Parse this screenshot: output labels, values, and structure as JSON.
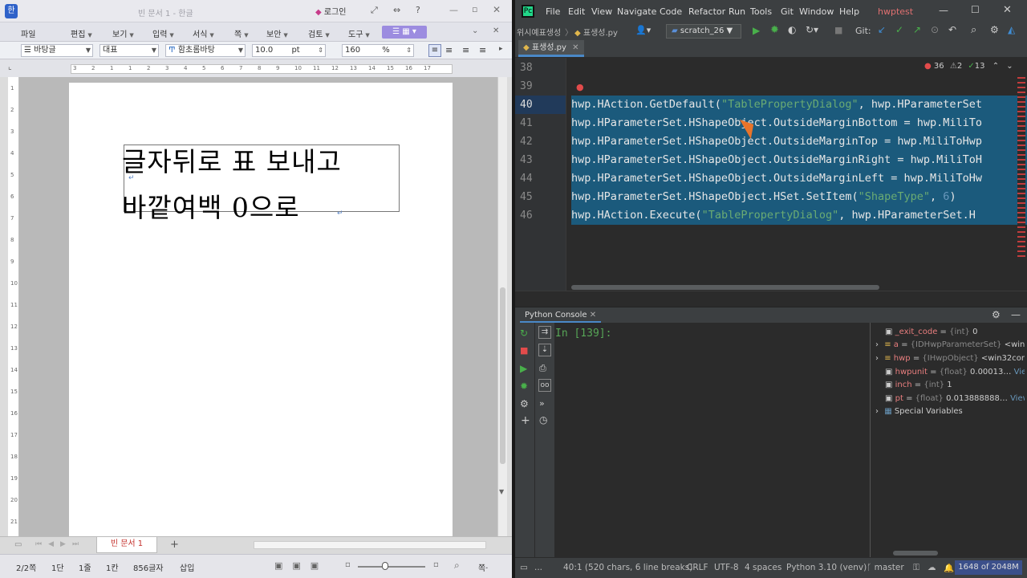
{
  "hwp": {
    "window_title": "빈 문서 1 - 한글",
    "login_label": "로그인",
    "menu": [
      "파일",
      "편집",
      "보기",
      "입력",
      "서식",
      "쪽",
      "보안",
      "검토",
      "도구"
    ],
    "format_bar": {
      "style": "바탕글",
      "lang": "대표",
      "font": "함초롬바탕",
      "size": "10.0",
      "size_unit": "pt",
      "zoom": "160",
      "zoom_unit": "%"
    },
    "ruler_numbers": [
      "3",
      "2",
      "1",
      "1",
      "2",
      "3",
      "4",
      "5",
      "6",
      "7",
      "8",
      "9",
      "10",
      "11",
      "12",
      "13",
      "14",
      "15",
      "16",
      "17"
    ],
    "vruler_numbers": [
      "1",
      "2",
      "3",
      "4",
      "5",
      "6",
      "7",
      "8",
      "9",
      "10",
      "11",
      "12",
      "13",
      "14",
      "15",
      "16",
      "17",
      "18",
      "19",
      "20",
      "21"
    ],
    "doc_line1": "글자뒤로 표 보내고",
    "doc_line2": "바깥여백 0으로",
    "doc_tab": "빈 문서 1",
    "status": {
      "page": "2/2쪽",
      "section": "1단",
      "line": "1줄",
      "col": "1칸",
      "chars": "856글자",
      "mode": "삽입",
      "zoom_tail": "쪽·"
    }
  },
  "ide": {
    "menu": [
      "File",
      "Edit",
      "View",
      "Navigate",
      "Code",
      "Refactor",
      "Run",
      "Tools",
      "Git",
      "Window",
      "Help"
    ],
    "project": "hwptest",
    "breadcrumb": "위시예표생성",
    "breadcrumb_file": "표생성.py",
    "run_config": "scratch_26",
    "git_label": "Git:",
    "file_tab": "표생성.py",
    "inspections": {
      "errors": "36",
      "warnings": "2",
      "ok": "13"
    },
    "lines": [
      {
        "no": "38",
        "text": ""
      },
      {
        "no": "39",
        "text": ""
      },
      {
        "no": "40",
        "a": "hwp.HAction.GetDefault(",
        "s": "\"TablePropertyDialog\"",
        "b": ", hwp.HParameterSet"
      },
      {
        "no": "41",
        "text": "hwp.HParameterSet.HShapeObject.OutsideMarginBottom = hwp.MiliTo"
      },
      {
        "no": "42",
        "text": "hwp.HParameterSet.HShapeObject.OutsideMarginTop = hwp.MiliToHwp"
      },
      {
        "no": "43",
        "text": "hwp.HParameterSet.HShapeObject.OutsideMarginRight = hwp.MiliToH"
      },
      {
        "no": "44",
        "text": "hwp.HParameterSet.HShapeObject.OutsideMarginLeft = hwp.MiliToHw"
      },
      {
        "no": "45",
        "a": "hwp.HParameterSet.HShapeObject.HSet.SetItem(",
        "s": "\"ShapeType\"",
        "b": ", ",
        "n": "6",
        "c": ")"
      },
      {
        "no": "46",
        "a": "hwp.HAction.Execute(",
        "s": "\"TablePropertyDialog\"",
        "b": ", hwp.HParameterSet.H"
      }
    ],
    "console_title": "Python Console",
    "prompt": "In [139]:",
    "variables": [
      {
        "name": "_exit_code",
        "type": "{int}",
        "value": "0",
        "expandable": false
      },
      {
        "name": "a",
        "type": "{IDHwpParameterSet}",
        "value": "<win3",
        "expandable": true
      },
      {
        "name": "hwp",
        "type": "{IHwpObject}",
        "value": "<win32com",
        "expandable": true
      },
      {
        "name": "hwpunit",
        "type": "{float}",
        "value": "0.00013…",
        "link": "View",
        "expandable": false
      },
      {
        "name": "inch",
        "type": "{int}",
        "value": "1",
        "expandable": false
      },
      {
        "name": "pt",
        "type": "{float}",
        "value": "0.013888888…",
        "link": "View",
        "expandable": false
      }
    ],
    "special_vars": "Special Variables",
    "status": {
      "position": "40:1 (520 chars, 6 line breaks)",
      "line_sep": "CRLF",
      "encoding": "UTF-8",
      "indent": "4 spaces",
      "interpreter": "Python 3.10 (venv)",
      "branch": "master",
      "memory": "1648 of 2048M"
    }
  }
}
